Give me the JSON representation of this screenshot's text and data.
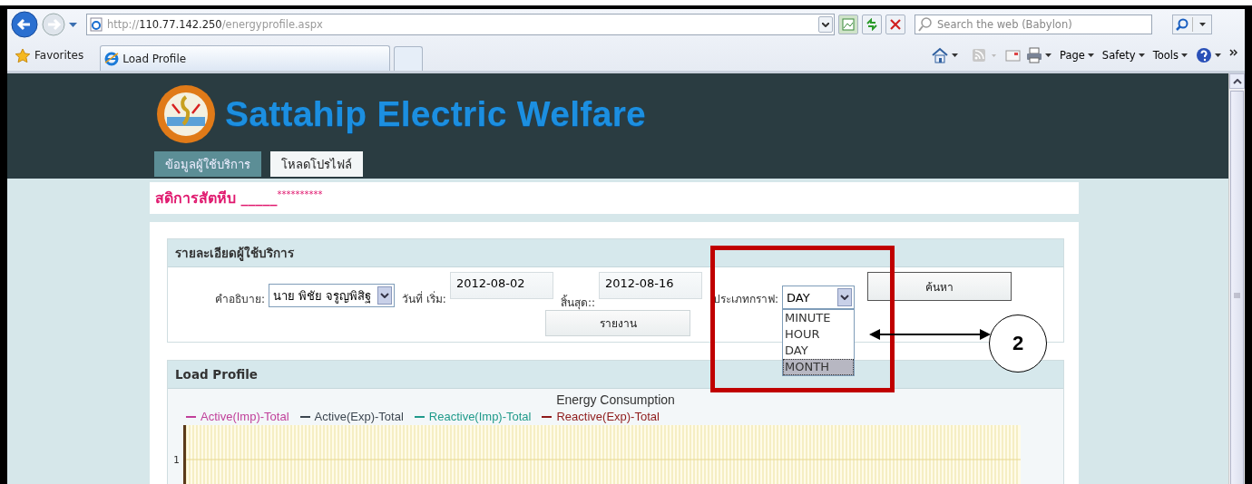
{
  "browser": {
    "address": {
      "scheme": "http://",
      "host": "110.77.142.250",
      "path": "/energyprofile.aspx"
    },
    "search": {
      "placeholder": "Search the web (Babylon)"
    },
    "favorites_label": "Favorites",
    "tabs": [
      {
        "label": "Load Profile",
        "selected": true
      }
    ],
    "command_menus": [
      "Page",
      "Safety",
      "Tools"
    ]
  },
  "site": {
    "title": "Sattahip Electric Welfare",
    "nav_tabs": [
      {
        "label": "ข้อมูลผู้ใช้บริการ",
        "selected": false
      },
      {
        "label": "โหลดโปรไฟล์",
        "selected": true
      }
    ],
    "welcome": {
      "name": "สดิการสัตหีบ",
      "blank": "_____",
      "masked": "**********"
    }
  },
  "details_panel": {
    "title": "รายละเอียดผู้ใช้บริการ",
    "description_label": "คำอธิบาย:",
    "description_value": "นาย พิชัย จรูญพิสิฐ",
    "start_label": "วันที่ เริ่ม:",
    "start_value": "2012-08-02",
    "end_label": "สิ้นสุด::",
    "end_value": "2012-08-16",
    "graph_type_label": "ประเภทกราฟ:",
    "graph_type_value": "DAY",
    "graph_type_open": true,
    "graph_type_options": [
      {
        "label": "MINUTE",
        "selected": false
      },
      {
        "label": "HOUR",
        "selected": false
      },
      {
        "label": "DAY",
        "selected": false
      },
      {
        "label": "MONTH",
        "selected": true
      }
    ],
    "search_button": "ค้นหา",
    "report_button": "รายงาน"
  },
  "load_profile": {
    "title": "Load Profile",
    "chart": {
      "title": "Energy Consumption",
      "legend": [
        {
          "label": "Active(Imp)-Total",
          "color": "#c0409a"
        },
        {
          "label": "Active(Exp)-Total",
          "color": "#3c4650"
        },
        {
          "label": "Reactive(Imp)-Total",
          "color": "#1f9a8a"
        },
        {
          "label": "Reactive(Exp)-Total",
          "color": "#8e1a1a"
        }
      ],
      "y_tick": "1"
    }
  },
  "annotation": {
    "callout": "2"
  }
}
